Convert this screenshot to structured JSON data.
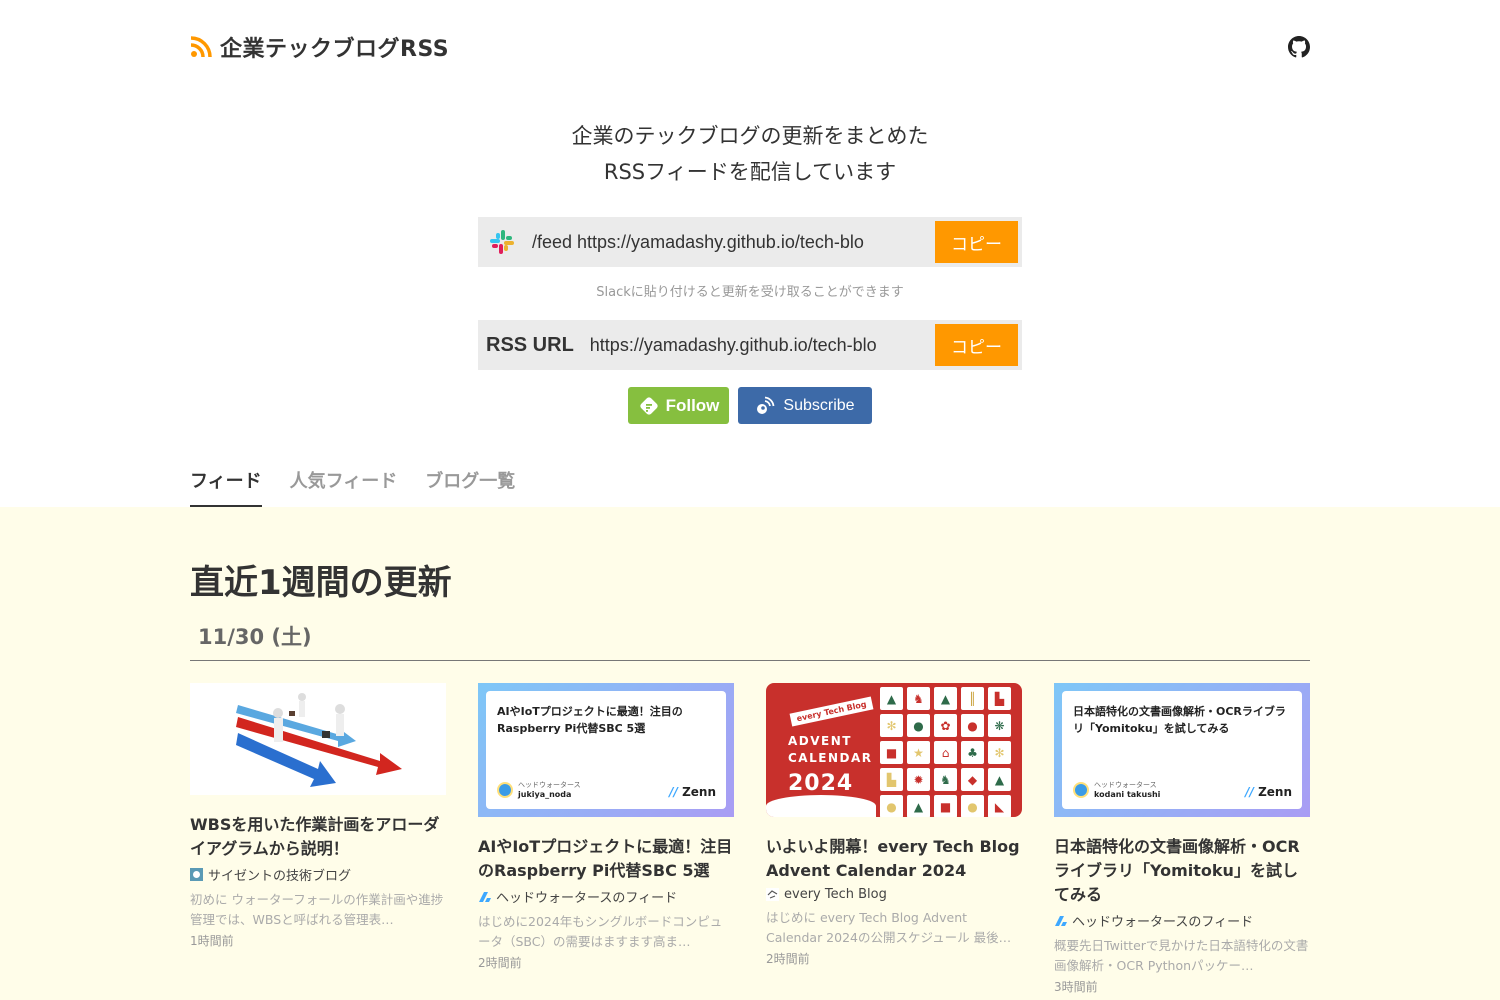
{
  "header": {
    "title": "企業テックブログRSS",
    "logo_icon": "rss-icon",
    "github_icon": "github-icon"
  },
  "hero": {
    "tagline_line1": "企業のテックブログの更新をまとめた",
    "tagline_line2": "RSSフィードを配信しています"
  },
  "slack_field": {
    "icon": "slack-icon",
    "value": "/feed https://yamadashy.github.io/tech-blo",
    "copy_label": "コピー",
    "hint": "Slackに貼り付けると更新を受け取ることができます"
  },
  "rss_field": {
    "label": "RSS URL",
    "value": "https://yamadashy.github.io/tech-blo",
    "copy_label": "コピー"
  },
  "social": {
    "follow_label": "Follow",
    "subscribe_label": "Subscribe"
  },
  "tabs": [
    {
      "label": "フィード",
      "active": true
    },
    {
      "label": "人気フィード",
      "active": false
    },
    {
      "label": "ブログ一覧",
      "active": false
    }
  ],
  "feed": {
    "title": "直近1週間の更新",
    "date": "11/30 (土)",
    "articles": [
      {
        "title": "WBSを用いた作業計画をアローダイアグラムから説明！",
        "source": "サイゼントの技術ブログ",
        "description": "初めに ウォーターフォールの作業計画や進捗管理では、WBSと呼ばれる管理表…",
        "time": "1時間前"
      },
      {
        "title": "AIやIoTプロジェクトに最適！注目のRaspberry Pi代替SBC 5選",
        "source": "ヘッドウォータースのフィード",
        "description": "はじめに2024年もシングルボードコンピュータ（SBC）の需要はますます高ま…",
        "time": "2時間前",
        "thumb_title": "AIやIoTプロジェクトに最適！注目のRaspberry Pi代替SBC 5選",
        "thumb_org": "ヘッドウォータース",
        "thumb_author": "jukiya_noda",
        "thumb_brand": "Zenn"
      },
      {
        "title": "いよいよ開幕！every Tech Blog Advent Calendar 2024",
        "source": "every Tech Blog",
        "description": "はじめに every Tech Blog Advent Calendar 2024の公開スケジュール 最後に …",
        "time": "2時間前",
        "thumb_flag": "every Tech Blog",
        "thumb_line1": "ADVENT",
        "thumb_line2": "CALENDAR",
        "thumb_year": "2024"
      },
      {
        "title": "日本語特化の文書画像解析・OCRライブラリ「Yomitoku」を試してみる",
        "source": "ヘッドウォータースのフィード",
        "description": "概要先日Twitterで見かけた日本語特化の文書画像解析・OCR Pythonパッケー…",
        "time": "3時間前",
        "thumb_title": "日本語特化の文書画像解析・OCRライブラリ「Yomitoku」を試してみる",
        "thumb_org": "ヘッドウォータース",
        "thumb_author": "kodani takushi",
        "thumb_brand": "Zenn"
      }
    ]
  },
  "colors": {
    "accent_orange": "#ff9800",
    "feedly_green": "#86bf3f",
    "inoreader_blue": "#3d6aa8",
    "feed_bg": "#fffde9"
  }
}
